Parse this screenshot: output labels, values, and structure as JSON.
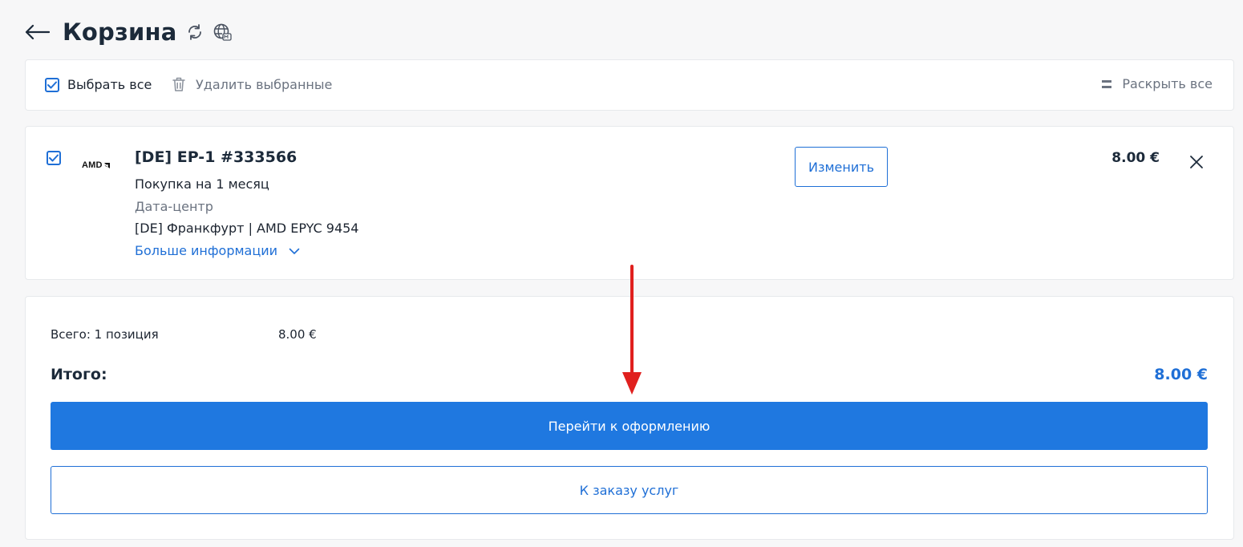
{
  "header": {
    "title": "Корзина",
    "icons": [
      "arrow-left-icon",
      "refresh-icon",
      "globe-icon"
    ]
  },
  "toolbar": {
    "select_all_label": "Выбрать все",
    "select_all_checked": true,
    "delete_selected_label": "Удалить выбранные",
    "expand_all_label": "Раскрыть все"
  },
  "cart_items": [
    {
      "checked": true,
      "logo_text": "AMD",
      "title": "[DE] EP-1 #333566",
      "period": "Покупка на 1 месяц",
      "datacenter_label": "Дата-центр",
      "datacenter_value": "[DE] Франкфурт | AMD EPYC 9454",
      "more_info_label": "Больше информации",
      "edit_label": "Изменить",
      "price": "8.00 €"
    }
  ],
  "summary": {
    "total_positions_label": "Всего: 1 позиция",
    "total_positions_value": "8.00 €",
    "grand_total_label": "Итого:",
    "grand_total_value": "8.00 €",
    "checkout_label": "Перейти к оформлению",
    "order_services_label": "К заказу услуг"
  },
  "colors": {
    "accent": "#1f78e0",
    "link": "#1f6fd6",
    "annotation_arrow": "#e0201e",
    "background": "#f7f7f8"
  }
}
